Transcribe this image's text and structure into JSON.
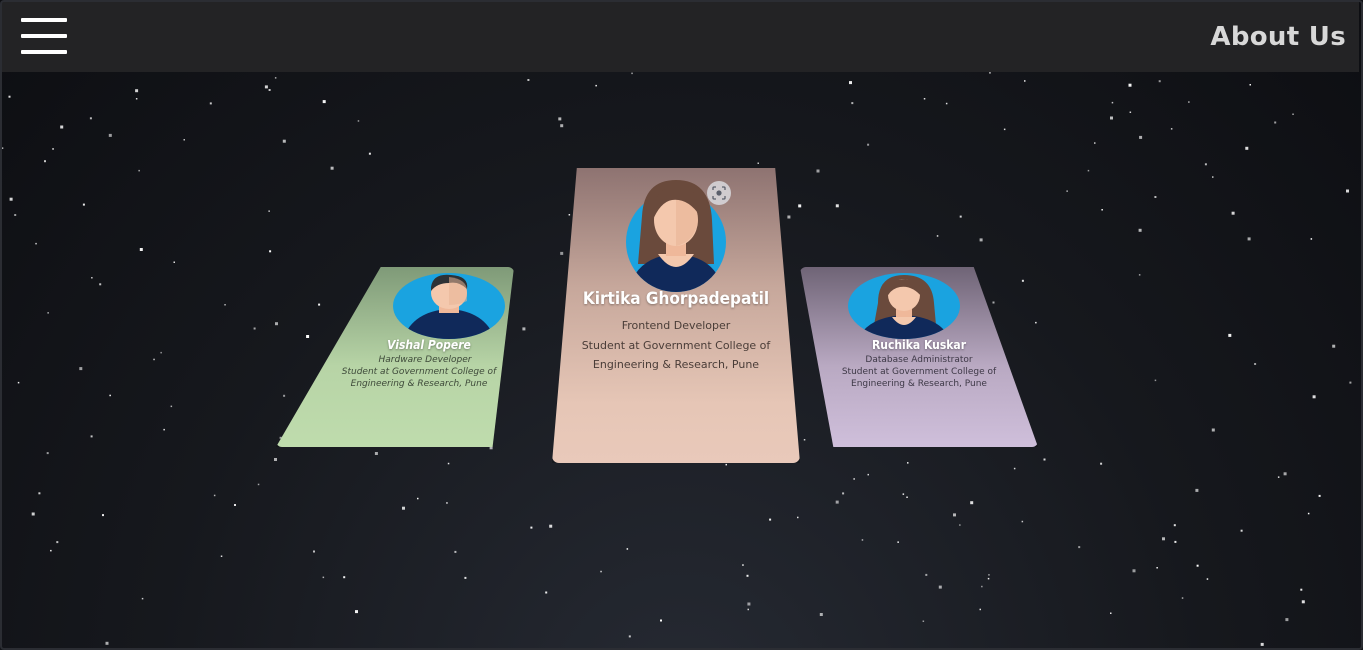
{
  "header": {
    "title": "About Us",
    "menu_icon": "hamburger-menu-icon"
  },
  "cards": [
    {
      "name": "Vishal Popere",
      "role": "Hardware Developer",
      "description": "Student at Government College of Engineering & Research, Pune",
      "color": "#bfdcad",
      "avatar": "male-avatar-icon"
    },
    {
      "name": "Kirtika Ghorpadepatil",
      "role": "Frontend Developer",
      "description": "Student at Government College of Engineering & Research, Pune",
      "color": "#e9c9ba",
      "avatar": "female-avatar-icon",
      "badge_icon": "visual-search-icon"
    },
    {
      "name": "Ruchika Kuskar",
      "role": "Database Administrator",
      "description": "Student at Government College of Engineering & Research, Pune",
      "color": "#cfbfdb",
      "avatar": "female-avatar-icon"
    }
  ],
  "colors": {
    "background": "#16181d",
    "header": "#232325",
    "avatar_ring": "#1aa3e0",
    "avatar_shirt": "#10295a"
  }
}
